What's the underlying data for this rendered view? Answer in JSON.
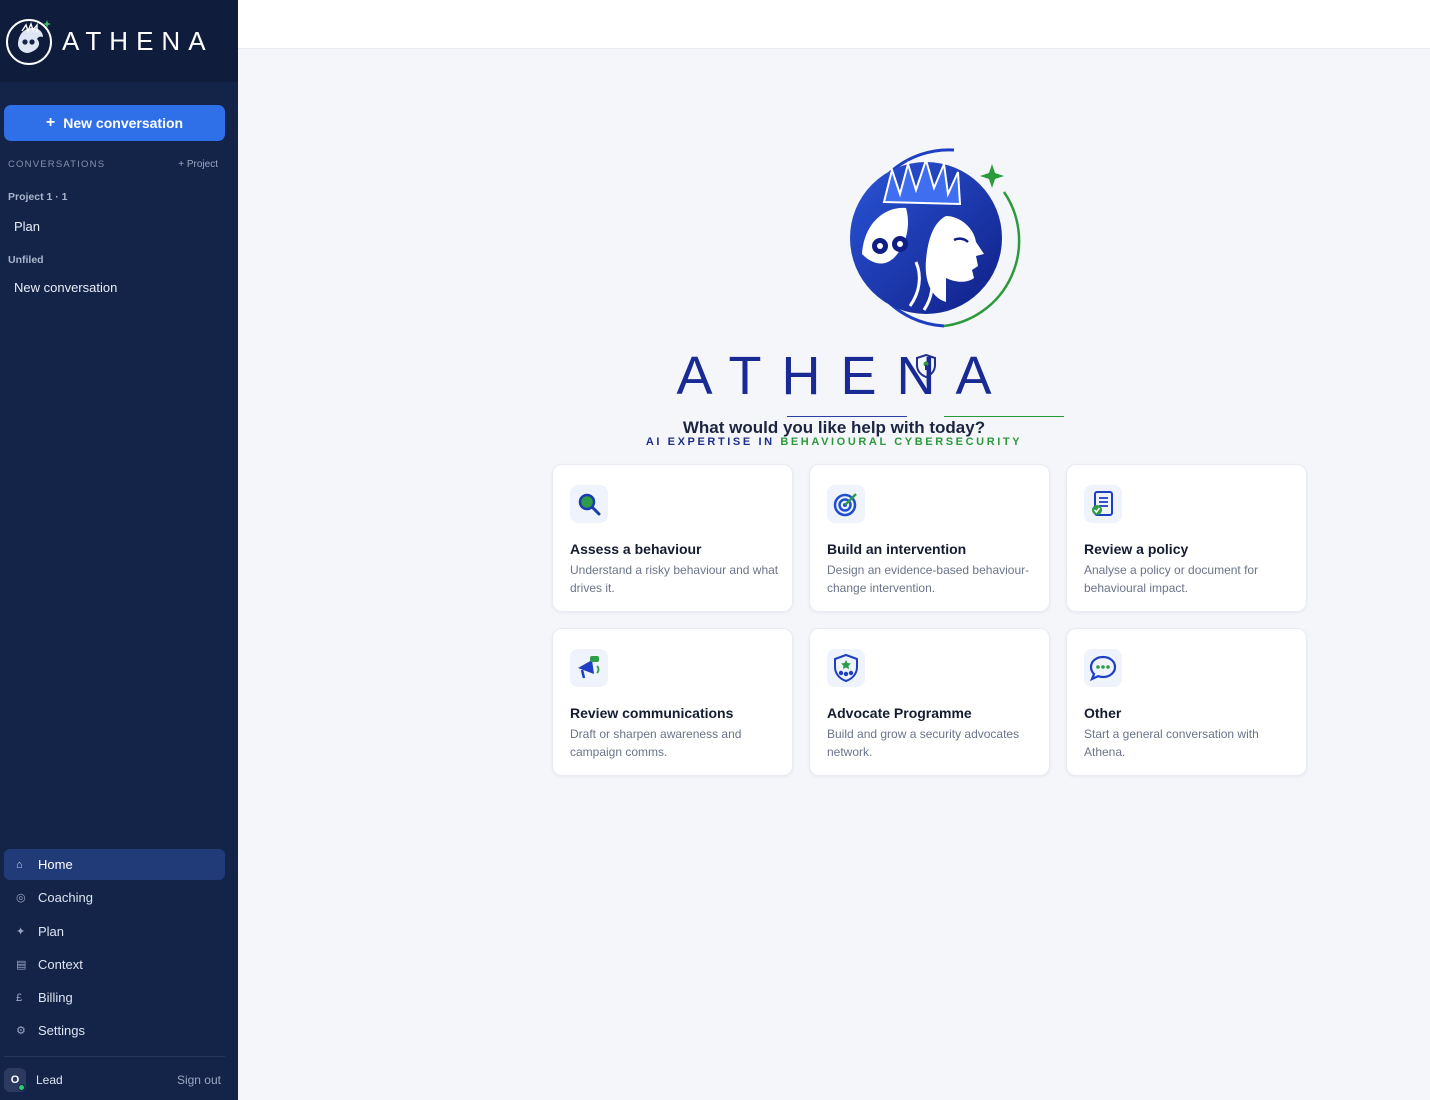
{
  "sidebar": {
    "brand": "ATHENA",
    "new_conversation": "New conversation",
    "conversations_label": "CONVERSATIONS",
    "add_project": "+ Project",
    "groups": [
      {
        "title": "Project 1 · 1",
        "items": [
          "Plan"
        ]
      },
      {
        "title": "Unfiled",
        "items": [
          "New conversation"
        ]
      }
    ],
    "nav": [
      {
        "label": "Home",
        "icon": "⌂",
        "icon_name": "home-icon",
        "active": true
      },
      {
        "label": "Coaching",
        "icon": "◎",
        "icon_name": "coaching-icon"
      },
      {
        "label": "Plan",
        "icon": "✦",
        "icon_name": "sparkle-icon"
      },
      {
        "label": "Context",
        "icon": "▤",
        "icon_name": "document-icon"
      },
      {
        "label": "Billing",
        "icon": "£",
        "icon_name": "pound-icon"
      },
      {
        "label": "Settings",
        "icon": "⚙",
        "icon_name": "gear-icon"
      }
    ],
    "user": {
      "initial": "O",
      "name": "Lead",
      "sign_out": "Sign out"
    }
  },
  "main": {
    "brand": "ATHENA",
    "tagline_part1": "AI EXPERTISE IN ",
    "tagline_part2": "BEHAVIOURAL CYBERSECURITY",
    "question": "What would you like help with today?",
    "cards": [
      {
        "title": "Assess a behaviour",
        "desc": "Understand a risky behaviour and what drives it.",
        "icon": "magnifier-icon"
      },
      {
        "title": "Build an intervention",
        "desc": "Design an evidence-based behaviour-change intervention.",
        "icon": "target-icon"
      },
      {
        "title": "Review a policy",
        "desc": "Analyse a policy or document for behavioural impact.",
        "icon": "policy-document-icon"
      },
      {
        "title": "Review communications",
        "desc": "Draft or sharpen awareness and campaign comms.",
        "icon": "megaphone-icon"
      },
      {
        "title": "Advocate Programme",
        "desc": "Build and grow a security advocates network.",
        "icon": "advocate-badge-icon"
      },
      {
        "title": "Other",
        "desc": "Start a general conversation with Athena.",
        "icon": "chat-bubble-icon"
      }
    ]
  },
  "colors": {
    "sidebar_bg": "#142449",
    "accent_blue": "#2f6fe8",
    "brand_navy": "#1a2a95",
    "brand_green": "#2a9a3a"
  }
}
